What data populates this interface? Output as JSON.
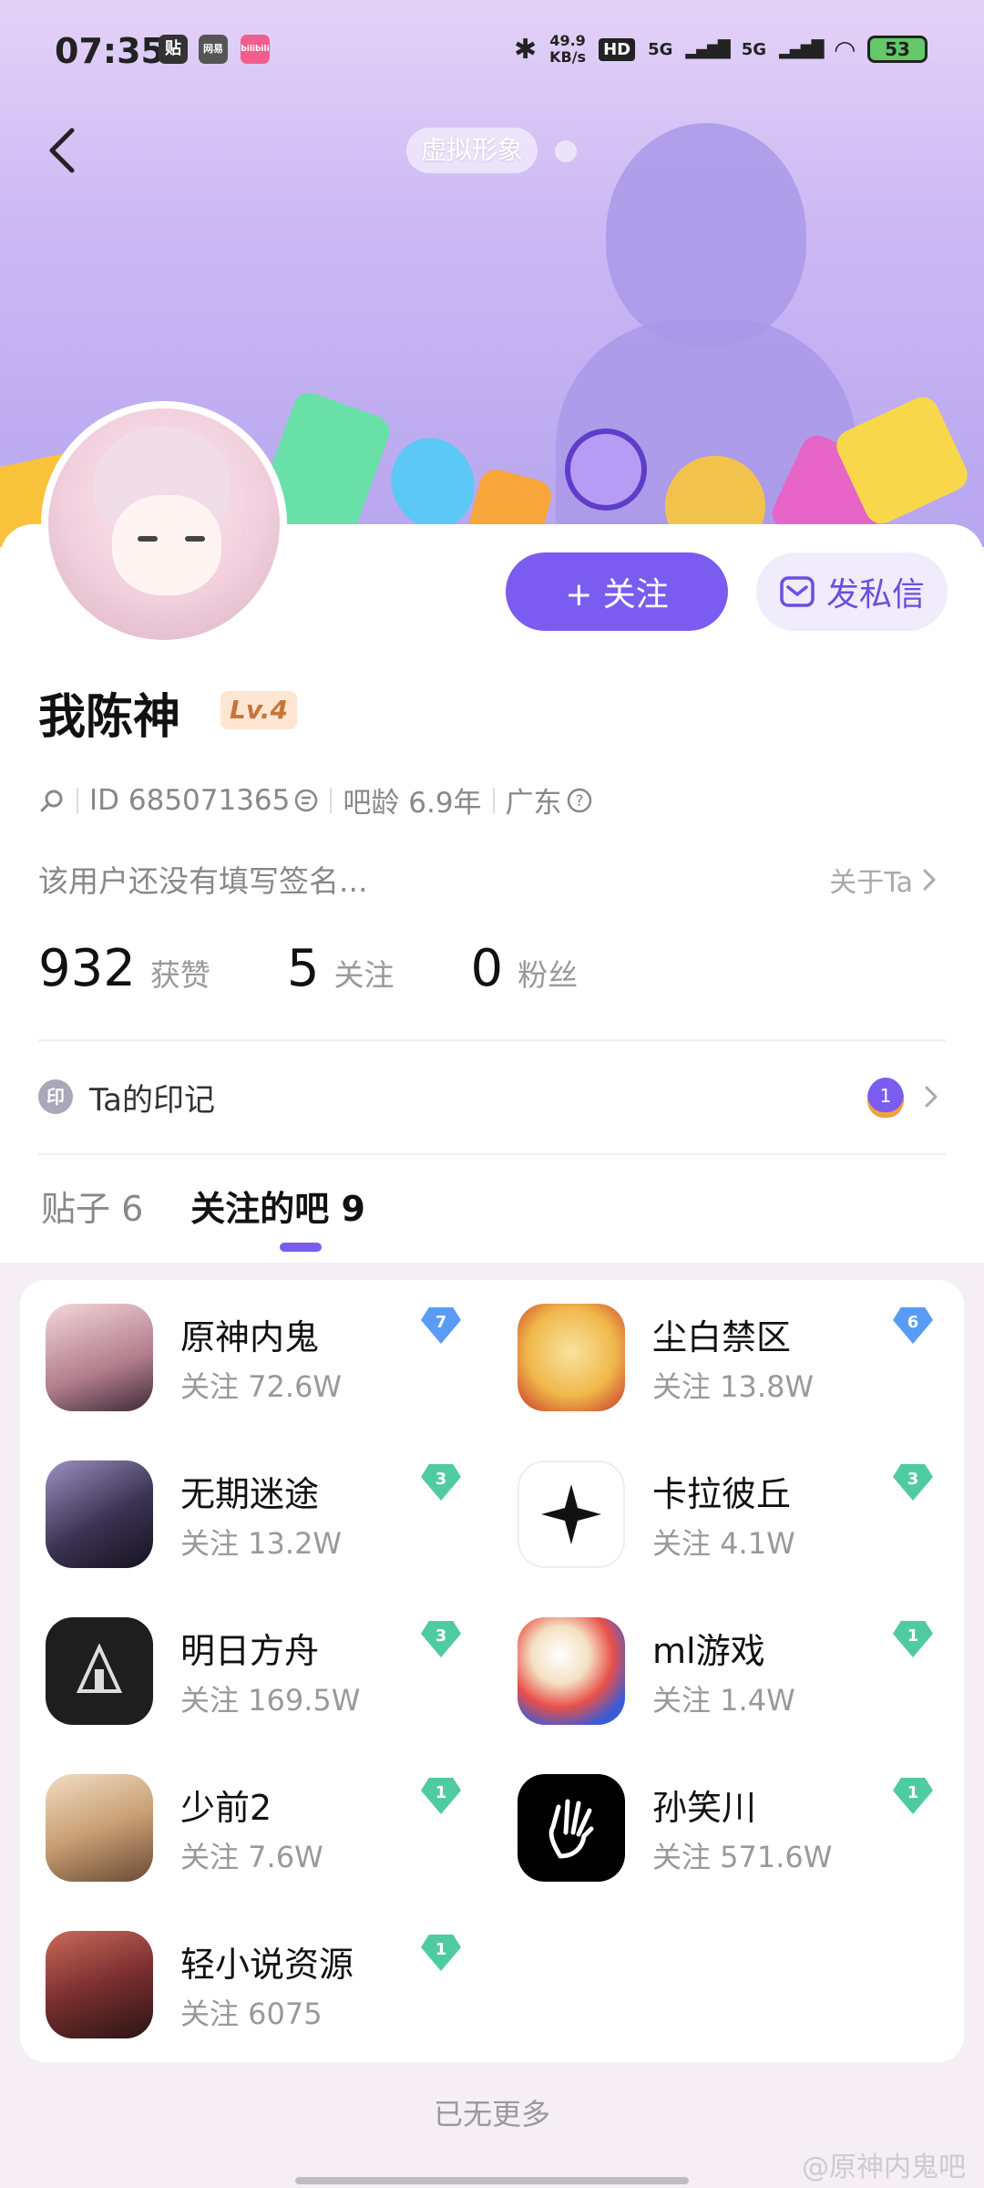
{
  "status_bar": {
    "time": "07:35",
    "app_icons": [
      "贴",
      "网易",
      "bilibili"
    ],
    "net_speed_value": "49.9",
    "net_speed_unit": "KB/s",
    "hd": "HD",
    "signal1": "5G",
    "signal2": "5G",
    "battery": "53"
  },
  "header": {
    "virtual_label": "虚拟形象"
  },
  "profile": {
    "follow_button": "+ 关注",
    "message_button": "发私信",
    "name": "我陈神",
    "level": "Lv.4",
    "id_text": "ID 685071365",
    "bar_age": "吧龄 6.9年",
    "location": "广东",
    "signature": "该用户还没有填写签名...",
    "about": "关于Ta",
    "stats": [
      {
        "value": "932",
        "label": "获赞"
      },
      {
        "value": "5",
        "label": "关注"
      },
      {
        "value": "0",
        "label": "粉丝"
      }
    ],
    "seal_icon": "印",
    "seal_label": "Ta的印记",
    "seal_medal": "1"
  },
  "tabs": [
    {
      "label": "贴子 6",
      "active": false
    },
    {
      "label": "关注的吧 9",
      "active": true
    }
  ],
  "forums": [
    {
      "name": "原神内鬼",
      "followers": "关注 72.6W",
      "level": "7",
      "level_color": "#5a9cf4",
      "avatar_color": "#c98f9d",
      "icon": "avatar-genshin"
    },
    {
      "name": "尘白禁区",
      "followers": "关注 13.8W",
      "level": "6",
      "level_color": "#5a9cf4",
      "avatar_color": "#f3c95a",
      "icon": "avatar-chenbai"
    },
    {
      "name": "无期迷途",
      "followers": "关注 13.2W",
      "level": "3",
      "level_color": "#4fcba0",
      "avatar_color": "#3b3352",
      "icon": "avatar-wuqi"
    },
    {
      "name": "卡拉彼丘",
      "followers": "关注 4.1W",
      "level": "3",
      "level_color": "#4fcba0",
      "avatar_color": "#1a1a1a",
      "icon": "avatar-kalabiqiu"
    },
    {
      "name": "明日方舟",
      "followers": "关注 169.5W",
      "level": "3",
      "level_color": "#4fcba0",
      "avatar_color": "#2a2a2a",
      "icon": "avatar-arknights"
    },
    {
      "name": "ml游戏",
      "followers": "关注 1.4W",
      "level": "1",
      "level_color": "#4fcba0",
      "avatar_color": "#e8504a",
      "icon": "avatar-mario"
    },
    {
      "name": "少前2",
      "followers": "关注 7.6W",
      "level": "1",
      "level_color": "#4fcba0",
      "avatar_color": "#c9a075",
      "icon": "avatar-shaoqian"
    },
    {
      "name": "孙笑川",
      "followers": "关注 571.6W",
      "level": "1",
      "level_color": "#4fcba0",
      "avatar_color": "#000000",
      "icon": "avatar-sunxiaochuan"
    },
    {
      "name": "轻小说资源",
      "followers": "关注 6075",
      "level": "1",
      "level_color": "#4fcba0",
      "avatar_color": "#7a2f2f",
      "icon": "avatar-novel"
    }
  ],
  "footer": {
    "no_more": "已无更多",
    "watermark": "@原神内鬼吧"
  },
  "colors": {
    "accent": "#7b5cf0",
    "banner_top": "#e3d2f7",
    "banner_bottom": "#b7a6ef"
  }
}
